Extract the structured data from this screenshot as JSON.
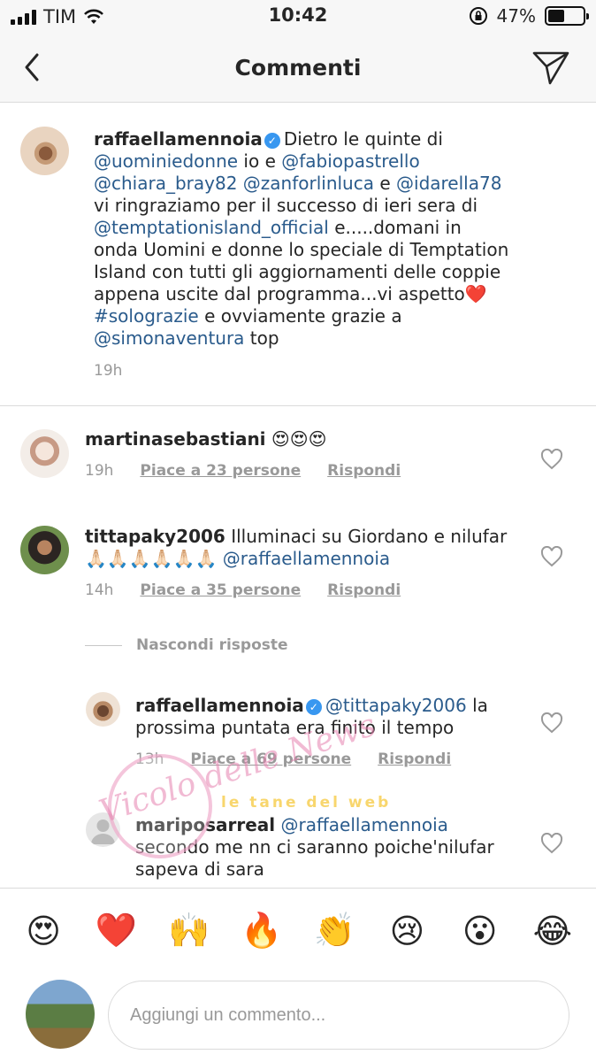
{
  "status_bar": {
    "carrier": "TIM",
    "time": "10:42",
    "battery": "47%",
    "battery_level": 0.47
  },
  "header": {
    "title": "Commenti",
    "back_icon": "chevron-left-icon",
    "send_icon": "direct-send-icon"
  },
  "caption": {
    "username": "raffaellamennoia",
    "segments": [
      {
        "t": "Dietro le quinte di ",
        "link": false
      },
      {
        "t": "@uominiedonne",
        "link": true
      },
      {
        "t": " io e ",
        "link": false
      },
      {
        "t": "@fabiopastrello",
        "link": true
      },
      {
        "t": " ",
        "link": false
      },
      {
        "t": "@chiara_bray82",
        "link": true
      },
      {
        "t": " ",
        "link": false
      },
      {
        "t": "@zanforlinluca",
        "link": true
      },
      {
        "t": " e ",
        "link": false
      },
      {
        "t": "@idarella78",
        "link": true
      },
      {
        "t": " vi ringraziamo per il successo di ieri sera di ",
        "link": false
      },
      {
        "t": "@temptationisland_official",
        "link": true
      },
      {
        "t": " e.....domani in onda Uomini e donne lo speciale di Temptation Island con tutti gli aggiornamenti delle coppie appena uscite dal programma...vi aspetto❤️",
        "link": false
      },
      {
        "t": "#solograzie",
        "link": true
      },
      {
        "t": " e ovviamente grazie a ",
        "link": false
      },
      {
        "t": "@simonaventura",
        "link": true
      },
      {
        "t": " top",
        "link": false
      }
    ],
    "time": "19h"
  },
  "comments": [
    {
      "username": "martinasebastiani",
      "text": "😍😍😍",
      "mention": "",
      "time": "19h",
      "likes": "Piace a 23 persone",
      "reply": "Rispondi"
    },
    {
      "username": "tittapaky2006",
      "text": "Illuminaci su Giordano e nilufar 🙏🏻🙏🏻🙏🏻🙏🏻🙏🏻🙏🏻 ",
      "mention": "@raffaellamennoia",
      "time": "14h",
      "likes": "Piace a 35 persone",
      "reply": "Rispondi"
    }
  ],
  "hide_replies": "Nascondi risposte",
  "replies": [
    {
      "username": "raffaellamennoia",
      "mention": "@tittapaky2006",
      "text": " la prossima puntata era finito il tempo",
      "time": "13h",
      "likes": "Piace a 69 persone",
      "reply": "Rispondi"
    },
    {
      "username": "mariposarreal",
      "mention": "@raffaellamennoia",
      "text": " secondo me nn ci saranno poiche'nilufar sapeva di sara"
    }
  ],
  "watermark": {
    "script_text": "Vicolo delle News",
    "yellow_text": "le tane del web"
  },
  "emoji_bar": [
    "😍",
    "❤️",
    "🙌",
    "🔥",
    "👏",
    "😢",
    "😮",
    "😂"
  ],
  "comment_input": {
    "placeholder": "Aggiungi un commento..."
  },
  "colors": {
    "link": "#2a5b8c",
    "meta": "#999999",
    "verified": "#3897f0",
    "divider": "#dbdbdb"
  }
}
